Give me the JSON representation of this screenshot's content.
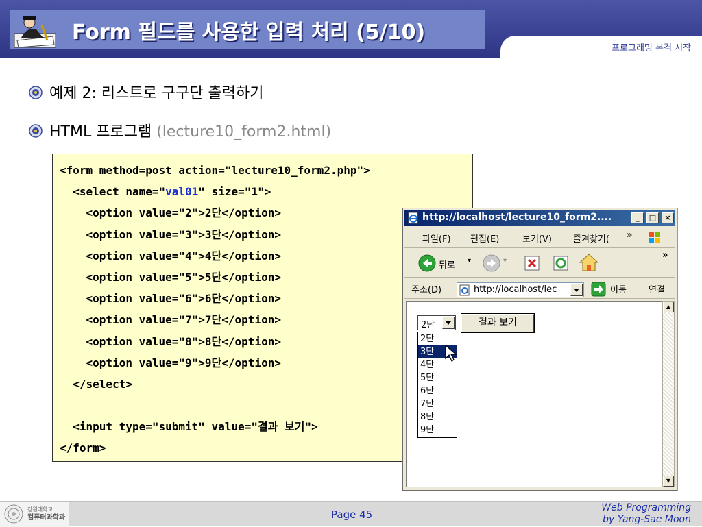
{
  "header": {
    "title": "Form 필드를 사용한 입력 처리 (5/10)",
    "subtitle": "프로그래밍 본격 시작"
  },
  "bullets": [
    {
      "prefix": "예제 2: ",
      "text": "리스트로 구구단 출력하기",
      "suffix": ""
    },
    {
      "prefix": "HTML ",
      "text": "프로그램 ",
      "suffix": "(lecture10_form2.html)"
    }
  ],
  "code": {
    "line1": "<form method=post action=\"lecture10_form2.php\">",
    "line2a": "  <select name=\"",
    "line2b": "val01",
    "line2c": "\" size=\"1\">",
    "options": [
      "    <option value=\"2\">2단</option>",
      "    <option value=\"3\">3단</option>",
      "    <option value=\"4\">4단</option>",
      "    <option value=\"5\">5단</option>",
      "    <option value=\"6\">6단</option>",
      "    <option value=\"7\">7단</option>",
      "    <option value=\"8\">8단</option>",
      "    <option value=\"9\">9단</option>"
    ],
    "close_select": "  </select>",
    "blank": " ",
    "input_line": "  <input type=\"submit\" value=\"결과 보기\">",
    "close_form": "</form>"
  },
  "browser": {
    "title": "http://localhost/lecture10_form2....",
    "menus": [
      "파일(F)",
      "편집(E)",
      "보기(V)",
      "즐겨찾기("
    ],
    "back_label": "뒤로",
    "address_label": "주소(D)",
    "address_value": "http://localhost/lec",
    "go_label": "이동",
    "links_label": "연결",
    "select_value": "2단",
    "submit_label": "결과 보기",
    "dropdown_items": [
      "2단",
      "3단",
      "4단",
      "5단",
      "6단",
      "7단",
      "8단",
      "9단"
    ],
    "dropdown_selected_index": 1
  },
  "footer": {
    "logo_line1": "강원대학교",
    "logo_line2": "컴퓨터과학과",
    "page": "Page 45",
    "credit_line1": "Web Programming",
    "credit_line2": "by Yang-Sae Moon"
  }
}
